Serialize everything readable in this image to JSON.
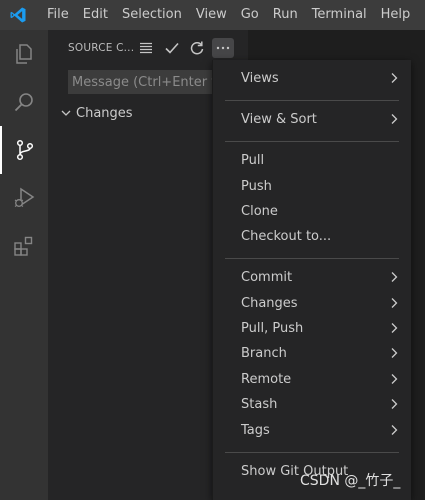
{
  "menubar": {
    "items": [
      "File",
      "Edit",
      "Selection",
      "View",
      "Go",
      "Run",
      "Terminal",
      "Help"
    ]
  },
  "activity": {
    "items": [
      "explorer-icon",
      "search-icon",
      "source-control-icon",
      "run-debug-icon",
      "extensions-icon"
    ],
    "active": "source-control-icon"
  },
  "sidebar": {
    "title": "SOURCE C...",
    "commit_placeholder": "Message (Ctrl+Enter to c",
    "changes_label": "Changes"
  },
  "menu": {
    "items": [
      {
        "label": "Views",
        "submenu": true
      },
      {
        "label": "View & Sort",
        "submenu": true
      },
      {
        "label": "Pull",
        "submenu": false
      },
      {
        "label": "Push",
        "submenu": false
      },
      {
        "label": "Clone",
        "submenu": false
      },
      {
        "label": "Checkout to...",
        "submenu": false
      },
      {
        "label": "Commit",
        "submenu": true
      },
      {
        "label": "Changes",
        "submenu": true
      },
      {
        "label": "Pull, Push",
        "submenu": true
      },
      {
        "label": "Branch",
        "submenu": true
      },
      {
        "label": "Remote",
        "submenu": true
      },
      {
        "label": "Stash",
        "submenu": true
      },
      {
        "label": "Tags",
        "submenu": true
      },
      {
        "label": "Show Git Output",
        "submenu": false
      }
    ]
  },
  "watermark": "CSDN @_竹子_",
  "colors": {
    "accent": "#0078d4",
    "titlebar": "#3c3c3c",
    "activitybar": "#333333",
    "sidebar": "#252526",
    "editor": "#1e1e1e"
  }
}
